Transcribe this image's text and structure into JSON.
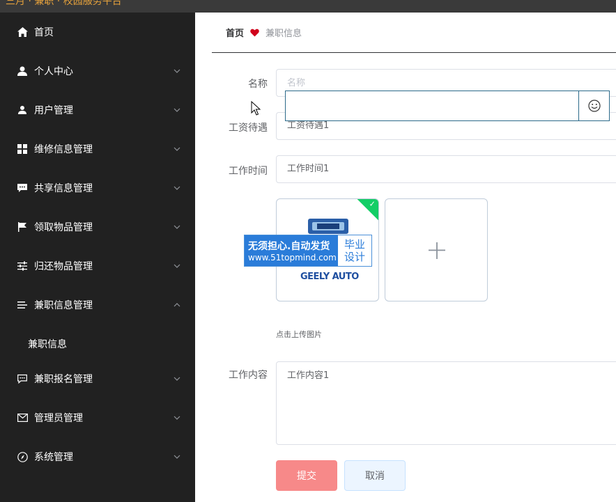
{
  "window": {
    "title": "三月 · 兼职 · 校园服务平台"
  },
  "sidebar": {
    "items": [
      {
        "label": "首页",
        "icon": "home-icon",
        "has_chevron": false
      },
      {
        "label": "个人中心",
        "icon": "user-icon",
        "has_chevron": true
      },
      {
        "label": "用户管理",
        "icon": "user-manage-icon",
        "has_chevron": true
      },
      {
        "label": "维修信息管理",
        "icon": "grid-icon",
        "has_chevron": true
      },
      {
        "label": "共享信息管理",
        "icon": "chat-icon",
        "has_chevron": true
      },
      {
        "label": "领取物品管理",
        "icon": "flag-icon",
        "has_chevron": true
      },
      {
        "label": "归还物品管理",
        "icon": "sliders-icon",
        "has_chevron": true
      },
      {
        "label": "兼职信息管理",
        "icon": "list-icon",
        "has_chevron": true,
        "expanded": true
      },
      {
        "label": "兼职信息",
        "icon": "",
        "has_chevron": false,
        "submenu": true
      },
      {
        "label": "兼职报名管理",
        "icon": "comment-icon",
        "has_chevron": true
      },
      {
        "label": "管理员管理",
        "icon": "mail-icon",
        "has_chevron": true
      },
      {
        "label": "系统管理",
        "icon": "compass-icon",
        "has_chevron": true
      }
    ]
  },
  "breadcrumb": {
    "home": "首页",
    "current": "兼职信息"
  },
  "form": {
    "name_label": "名称",
    "name_placeholder": "名称",
    "name_value": "",
    "salary_label": "工资待遇",
    "salary_value": "工资待遇1",
    "time_label": "工作时间",
    "time_value": "工作时间1",
    "upload_hint": "点击上传图片",
    "image_caption": "GEELY AUTO",
    "content_label": "工作内容",
    "content_value": "工作内容1",
    "submit_label": "提交",
    "cancel_label": "取消"
  },
  "watermark": {
    "line1": "无须担心.自动发货",
    "line2": "www.51topmind.com",
    "right1": "毕业",
    "right2": "设计"
  },
  "colors": {
    "sidebar_bg": "#212121",
    "submit_bg": "#f78989",
    "cancel_bg": "#ecf5ff",
    "heart": "#d0021b",
    "upload_success": "#13ce66"
  }
}
